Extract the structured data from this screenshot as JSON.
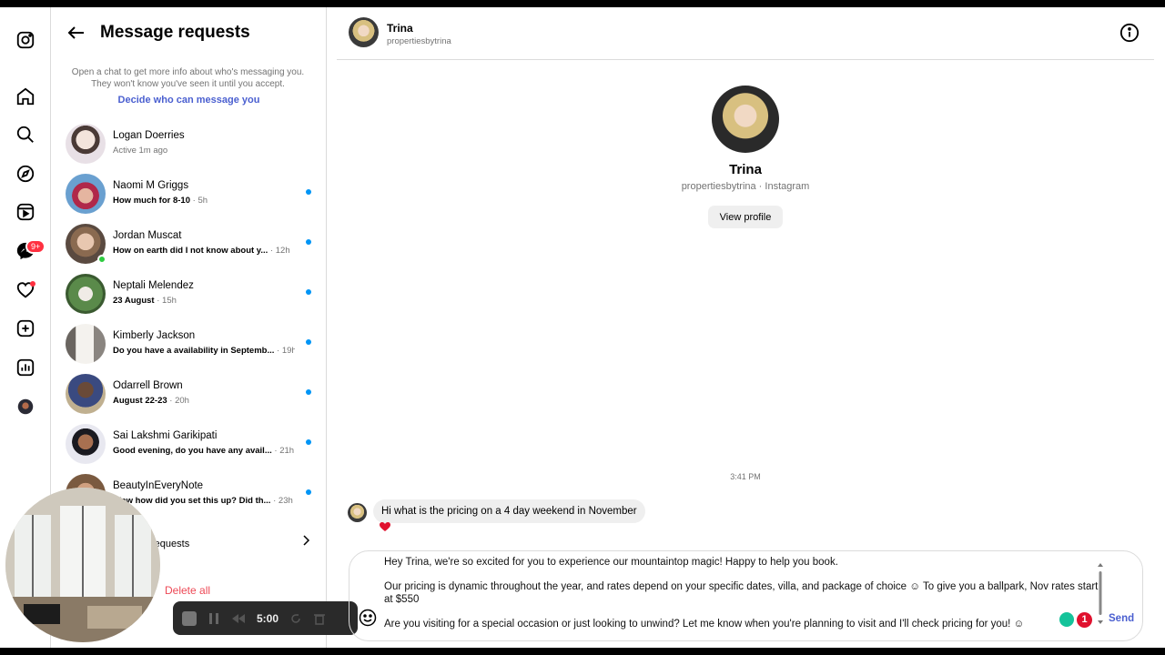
{
  "panel": {
    "title": "Message requests",
    "info": "Open a chat to get more info about who's messaging you. They won't know you've seen it until you accept.",
    "decide_link": "Decide who can message you",
    "hidden_requests": "requests",
    "delete_all": "Delete all"
  },
  "nav": {
    "badge": "9+"
  },
  "requests": [
    {
      "name": "Logan Doerries",
      "preview": "",
      "status": "Active 1m ago",
      "time": "",
      "unread": false
    },
    {
      "name": "Naomi M Griggs",
      "preview": "How much for 8-10",
      "time": "5h",
      "unread": true
    },
    {
      "name": "Jordan Muscat",
      "preview": "How on earth did I not know about y...",
      "time": "12h",
      "unread": true
    },
    {
      "name": "Neptali Melendez",
      "preview": "23 August",
      "time": "15h",
      "unread": true
    },
    {
      "name": "Kimberly Jackson",
      "preview": "Do you have a availability in Septemb...",
      "time": "19h",
      "unread": true
    },
    {
      "name": "Odarrell Brown",
      "preview": "August 22-23",
      "time": "20h",
      "unread": true
    },
    {
      "name": "Sai Lakshmi Garikipati",
      "preview": "Good evening, do you have any avail...",
      "time": "21h",
      "unread": true
    },
    {
      "name": "BeautyInEveryNote",
      "preview": "Wow how did you set this up? Did th...",
      "time": "23h",
      "unread": true
    }
  ],
  "recorder": {
    "time": "5:00"
  },
  "chat": {
    "name": "Trina",
    "username": "propertiesbytrina",
    "profile_name": "Trina",
    "profile_sub": "propertiesbytrina · Instagram",
    "view_profile": "View profile",
    "timestamp": "3:41 PM",
    "incoming": "Hi what is the pricing on a 4 day weekend in November",
    "draft": [
      "Hey Trina, we're so excited for you to experience our mountaintop magic! Happy to help you book.",
      "Our pricing is dynamic throughout the year, and rates depend on your specific dates, villa, and package of choice ☺ To give you a ballpark, Nov rates start at $550",
      "Are you visiting for a special occasion or just looking to unwind? Let me know when you're planning to visit and I'll check pricing for you! ☺"
    ],
    "send": "Send",
    "ext_count": "1"
  }
}
